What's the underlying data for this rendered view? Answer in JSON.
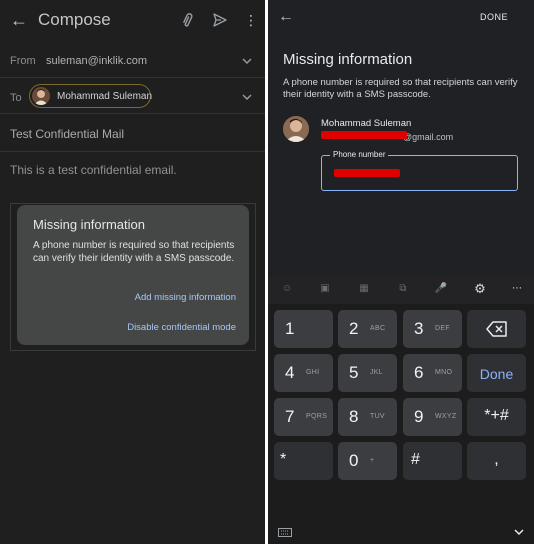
{
  "compose": {
    "title": "Compose",
    "from_label": "From",
    "from_value": "suleman@inklik.com",
    "to_label": "To",
    "to_chip_name": "Mohammad Suleman",
    "subject": "Test Confidential Mail",
    "body": "This is a test confidential email.",
    "dialog": {
      "title": "Missing information",
      "message": "A phone number is required so that recipients can verify their identity with a SMS passcode.",
      "add_link": "Add missing information",
      "disable_link": "Disable confidential mode"
    }
  },
  "missing_info": {
    "done_label": "DONE",
    "title": "Missing information",
    "message": "A phone number is required so that recipients can verify their identity with a SMS passcode.",
    "recipient_name": "Mohammad Suleman",
    "recipient_email_suffix": "@gmail.com",
    "phone_field_label": "Phone number"
  },
  "keyboard": {
    "keys": [
      {
        "main": "1",
        "sub": ""
      },
      {
        "main": "2",
        "sub": "ABC"
      },
      {
        "main": "3",
        "sub": "DEF"
      },
      {
        "main": "4",
        "sub": "GHI"
      },
      {
        "main": "5",
        "sub": "JKL"
      },
      {
        "main": "6",
        "sub": "MNO"
      },
      {
        "main": "7",
        "sub": "PQRS"
      },
      {
        "main": "8",
        "sub": "TUV"
      },
      {
        "main": "9",
        "sub": "WXYZ"
      },
      {
        "main": "0",
        "sub": "+"
      }
    ],
    "done_key": "Done",
    "star_hash_key": "*+#",
    "star_key": "*",
    "hash_key": "#",
    "comma_key": ","
  },
  "colors": {
    "accent_link": "#a8c7fa",
    "field_border": "#8ab4f8",
    "redaction": "#e00000",
    "chip_border": "#7a6a2e"
  }
}
